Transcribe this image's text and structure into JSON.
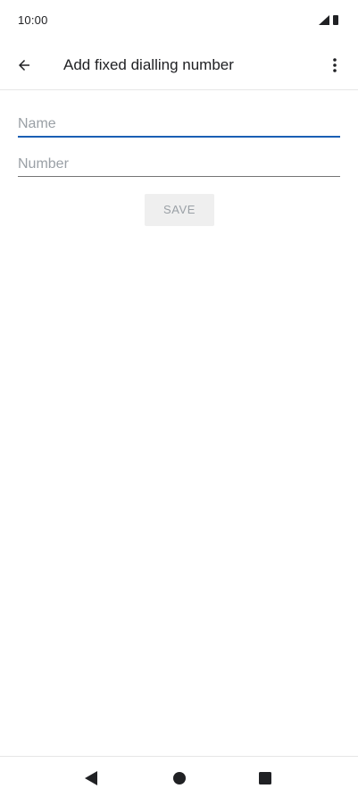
{
  "status_bar": {
    "time": "10:00",
    "icons": [
      "signal-icon",
      "battery-icon"
    ]
  },
  "app_bar": {
    "title": "Add fixed dialling number",
    "back_icon": "arrow-left-icon",
    "overflow_icon": "more-vert-icon"
  },
  "form": {
    "name": {
      "placeholder": "Name",
      "value": ""
    },
    "number": {
      "placeholder": "Number",
      "value": ""
    },
    "save_label": "SAVE"
  },
  "nav_bar": {
    "items": [
      "back-triangle-icon",
      "home-circle-icon",
      "recents-square-icon"
    ]
  },
  "colors": {
    "accent": "#1a5fb4",
    "text": "#202124",
    "hint": "#9aa0a6",
    "button_bg": "#efefef"
  }
}
